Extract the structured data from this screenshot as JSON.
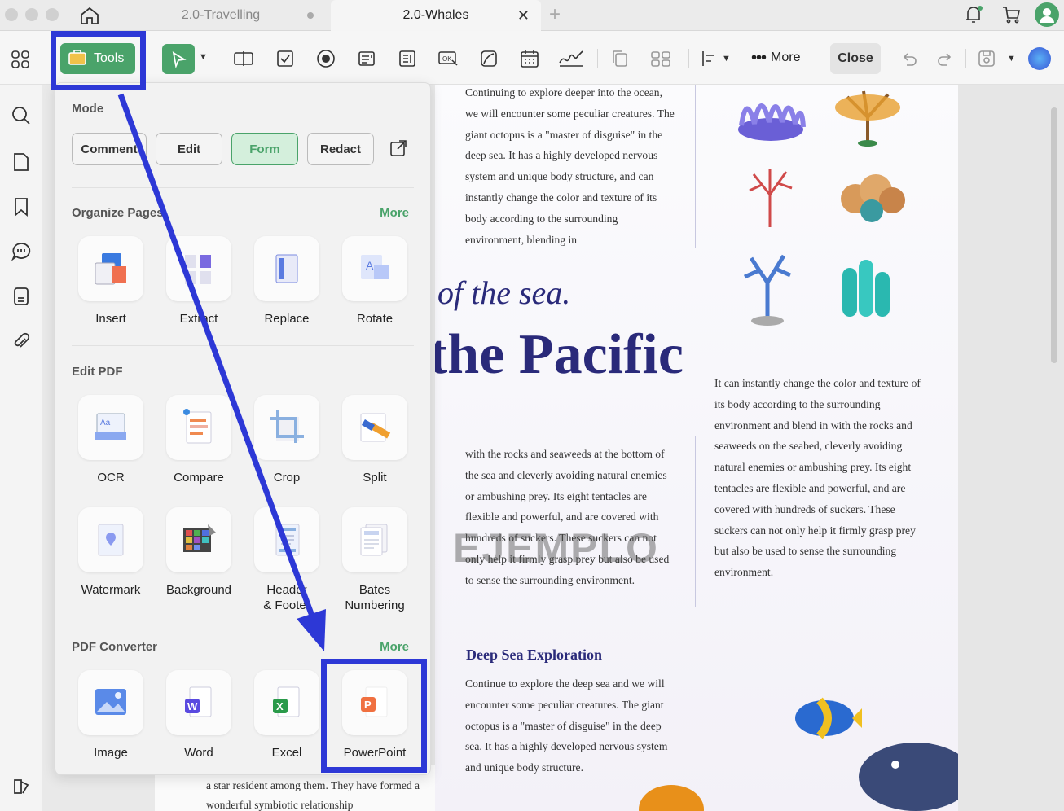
{
  "tabs": [
    {
      "label": "2.0-Travelling"
    },
    {
      "label": "2.0-Whales"
    }
  ],
  "toolbar": {
    "tools_label": "Tools",
    "more_label": "More",
    "close_label": "Close"
  },
  "panel": {
    "mode_title": "Mode",
    "modes": [
      "Comment",
      "Edit",
      "Form",
      "Redact"
    ],
    "organize": {
      "title": "Organize Pages",
      "more": "More",
      "items": [
        "Insert",
        "Extract",
        "Replace",
        "Rotate"
      ]
    },
    "edit": {
      "title": "Edit PDF",
      "items": [
        "OCR",
        "Compare",
        "Crop",
        "Split",
        "Watermark",
        "Background",
        "Header\n& Footer",
        "Bates\nNumbering"
      ]
    },
    "converter": {
      "title": "PDF Converter",
      "more": "More",
      "items": [
        "Image",
        "Word",
        "Excel",
        "PowerPoint"
      ]
    }
  },
  "doc": {
    "para1": "Continuing to explore deeper into the ocean, we will encounter some peculiar creatures. The giant octopus is a \"master of disguise\" in the deep sea. It has a highly developed nervous system and unique body structure, and can instantly change the color and texture of its body according to the surrounding environment, blending in",
    "heading_italic": "of the sea.",
    "heading_big": "the Pacific",
    "para2": "with the rocks and seaweeds at the bottom of the sea and cleverly avoiding natural enemies or ambushing prey. Its eight tentacles are flexible and powerful, and are covered with hundreds of suckers. These suckers can not only help it firmly grasp prey but also be used to sense the surrounding environment.",
    "watermark": "EJEMPLO",
    "para3": "It can instantly change the color and texture of its body according to the surrounding environment and blend in with the rocks and seaweeds on the seabed, cleverly avoiding natural enemies or ambushing prey. Its eight tentacles are flexible and powerful, and are covered with hundreds of suckers. These suckers can not only help it firmly grasp prey but also be used to sense the surrounding environment.",
    "subheading": "Deep Sea Exploration",
    "para4": "Continue to explore the deep sea and we will encounter some peculiar creatures. The giant octopus is a \"master of disguise\" in the deep sea. It has a highly developed nervous system and unique body structure.",
    "para5": "a star resident among them. They have formed a wonderful symbiotic relationship"
  },
  "colors": {
    "accent": "#4aa36a",
    "highlight": "#2d38d6",
    "heading": "#2a2a7a"
  }
}
